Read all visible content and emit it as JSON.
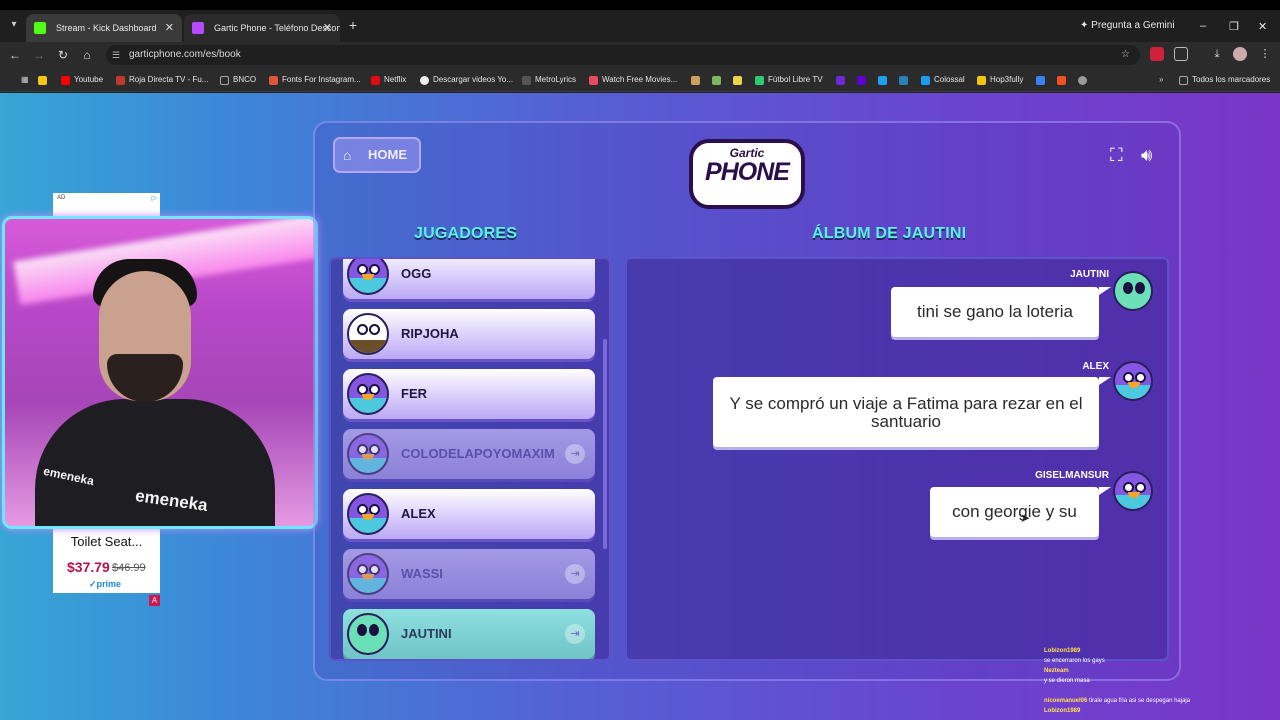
{
  "browser": {
    "tabs": [
      {
        "title": "Stream - Kick Dashboard",
        "favicon_color": "#53fc18"
      },
      {
        "title": "Gartic Phone - Teléfono Descon",
        "favicon_color": "#b44bff"
      }
    ],
    "gemini_label": "Pregunta a Gemini",
    "url": "garticphone.com/es/book",
    "bookmarks": [
      {
        "label": "",
        "color": "#f5c518"
      },
      {
        "label": "Youtube",
        "color": "#ff0000"
      },
      {
        "label": "Roja Directa TV - Fu...",
        "color": "#c0392b"
      },
      {
        "label": "BNCO",
        "color": "#888888"
      },
      {
        "label": "Fonts For Instagram...",
        "color": "#e0563b"
      },
      {
        "label": "Netflix",
        "color": "#e50914"
      },
      {
        "label": "Descargar videos Yo...",
        "color": "#ffffff"
      },
      {
        "label": "MetroLyrics",
        "color": "#333333"
      },
      {
        "label": "Watch Free Movies...",
        "color": "#e84a5f"
      },
      {
        "label": "Fútbol Libre TV",
        "color": "#2ecc71"
      },
      {
        "label": "Colossal",
        "color": "#1d9bf0"
      },
      {
        "label": "Hop3fully",
        "color": "#f1c40f"
      },
      {
        "label": "Todos los marcadores",
        "color": "#aaaaaa"
      }
    ]
  },
  "ad": {
    "label": "AD",
    "title": "Toilet Seat...",
    "price": "$37.79",
    "old_price": "$46.99",
    "prime": "✓prime",
    "badge": "A"
  },
  "webcam": {
    "shirt_text": "emeneka",
    "sleeve_text": "emeneka"
  },
  "game": {
    "home_label": "HOME",
    "logo_top": "Gartic",
    "logo_main": "PHONE",
    "players_heading": "JUGADORES",
    "album_heading": "ÁLBUM DE JAUTINI",
    "players": [
      {
        "name": "OGG",
        "state": "active",
        "avatar": "bird"
      },
      {
        "name": "RIPJOHA",
        "state": "active",
        "avatar": "green"
      },
      {
        "name": "FER",
        "state": "active",
        "avatar": "bird"
      },
      {
        "name": "COLODELAPOYOMAXIM",
        "state": "left",
        "avatar": "bird"
      },
      {
        "name": "ALEX",
        "state": "active",
        "avatar": "bird"
      },
      {
        "name": "WASSI",
        "state": "left",
        "avatar": "bird"
      },
      {
        "name": "JAUTINI",
        "state": "owner-left",
        "avatar": "alien"
      }
    ],
    "messages": [
      {
        "author": "JAUTINI",
        "text": "tini se gano la loteria",
        "avatar": "alien"
      },
      {
        "author": "ALEX",
        "text": "Y se compró un viaje a Fatima para rezar en el santuario",
        "avatar": "bird"
      },
      {
        "author": "GISELMANSUR",
        "text": "con georgie y su",
        "avatar": "bird"
      }
    ]
  },
  "chat_overlay": [
    {
      "user": "Lobizon1989",
      "text": ""
    },
    {
      "user": "",
      "text": "se encerraron los gays"
    },
    {
      "user": "Nezteam",
      "text": ""
    },
    {
      "user": "",
      "text": "y se dieron masa"
    },
    {
      "user": "",
      "text": ""
    },
    {
      "user": "nicoemanuel06",
      "text": "tirale agua fria asi se despegan hajaja"
    },
    {
      "user": "Lobizon1989",
      "text": ""
    }
  ]
}
